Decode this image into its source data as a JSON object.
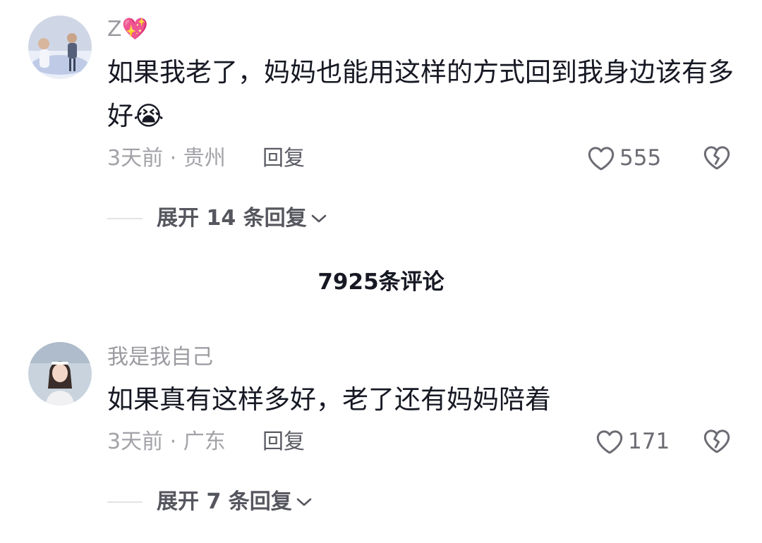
{
  "comment_count_label": "7925条评论",
  "comments": [
    {
      "username": "Z",
      "username_emoji": "💖",
      "text": "如果我老了，妈妈也能用这样的方式回到我身边该有多好",
      "text_emoji": "😭",
      "time": "3天前",
      "location": "贵州",
      "meta_separator": " · ",
      "reply_label": "回复",
      "likes": "555",
      "expand_label": "展开 14 条回复",
      "expand_icon": "chevron-down-icon"
    },
    {
      "username": "我是我自己",
      "text": "如果真有这样多好，老了还有妈妈陪着",
      "time": "3天前",
      "location": "广东",
      "meta_separator": " · ",
      "reply_label": "回复",
      "likes": "171",
      "expand_label": "展开 7 条回复",
      "expand_icon": "chevron-down-icon"
    }
  ]
}
